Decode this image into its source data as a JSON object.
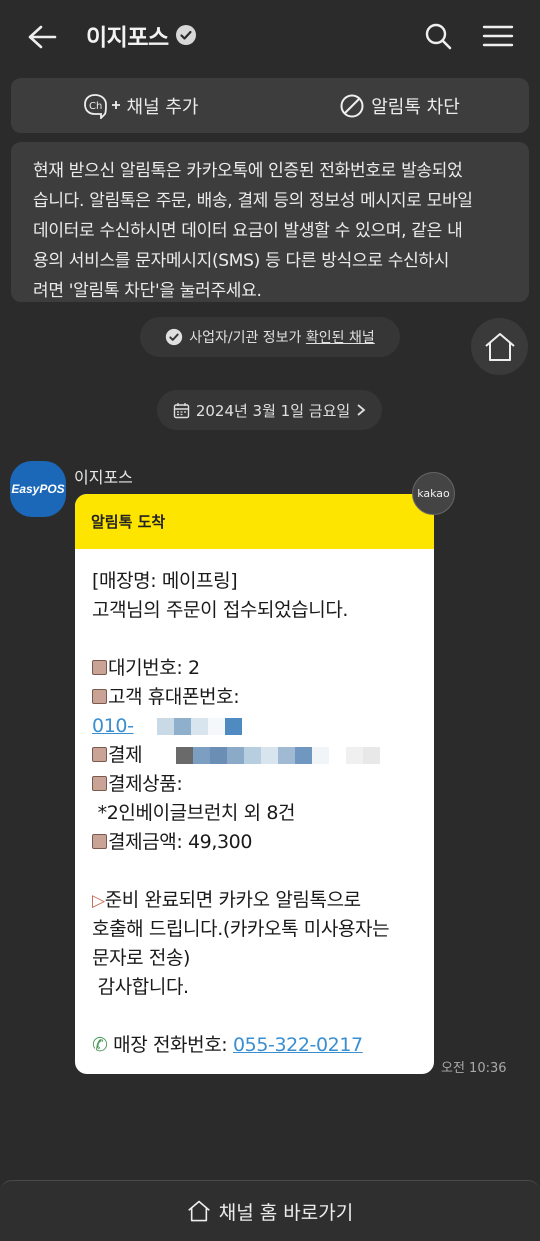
{
  "header": {
    "title": "이지포스",
    "icons": {
      "back": "arrow-left-icon",
      "verified": "verified-badge-icon",
      "search": "search-icon",
      "menu": "menu-icon"
    }
  },
  "actions": {
    "add_channel_label": "채널 추가",
    "add_channel_icon_text": "Ch",
    "block_label": "알림톡 차단"
  },
  "notice": {
    "text": "현재 받으신 알림톡은 카카오톡에 인증된 전화번호로 발송되었\n습니다. 알림톡은 주문, 배송, 결제 등의 정보성 메시지로 모바일\n 데이터로 수신하시면 데이터 요금이 발생할 수 있으며, 같은 내\n용의 서비스를 문자메시지(SMS) 등 다른 방식으로 수신하시\n려면 '알림톡 차단'을 눌러주세요."
  },
  "verified_chip": {
    "prefix": "사업자/기관 정보가 ",
    "link": "확인된 채널"
  },
  "date_chip": {
    "label": "2024년 3월 1일 금요일"
  },
  "message": {
    "sender": "이지포스",
    "avatar_text": "EasyPOS",
    "badge": "kakao",
    "head": "알림톡 도착",
    "lines": {
      "store": "[매장명: 메이프링]",
      "received": "고객님의 주문이 접수되었습니다.",
      "wait_no": "대기번호: 2",
      "phone_label": "고객 휴대폰번호:",
      "phone_prefix": "010-",
      "pay_partial": "결제",
      "product_label": "결제상품:",
      "product_item": " *2인베이글브런치 외 8건",
      "amount": "결제금액: 49,300",
      "ready_1": "준비 완료되면 카카오 알림톡으로",
      "ready_2": "호출해 드립니다.(카카오톡 미사용자는",
      "ready_3": "문자로 전송)",
      "thanks": " 감사합니다.",
      "store_phone_label": "매장 전화번호: ",
      "store_phone": "055-322-0217"
    },
    "time": "오전 10:36"
  },
  "bottom": {
    "label": "채널 홈 바로가기"
  }
}
